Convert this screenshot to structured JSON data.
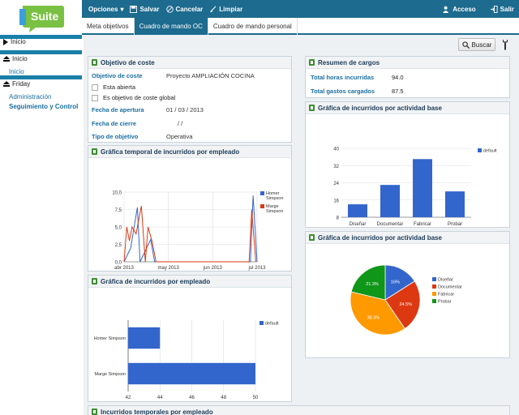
{
  "logo": {
    "text": "Suite"
  },
  "sidebar": {
    "items": [
      {
        "label": "Inicio"
      },
      {
        "label": "Inicio"
      },
      {
        "label": "Inicio"
      },
      {
        "label": "Friday"
      },
      {
        "label": "Administración"
      },
      {
        "label": "Seguimiento y Control"
      }
    ]
  },
  "topbar": {
    "opciones": "Opciones",
    "salvar": "Salvar",
    "cancelar": "Cancelar",
    "limpiar": "Limpiar",
    "acceso": "Acceso",
    "salir": "Salir"
  },
  "tabs": [
    {
      "label": "Meta objetivos"
    },
    {
      "label": "Cuadro de mando OC"
    },
    {
      "label": "Cuadro de mando personal"
    }
  ],
  "search": {
    "label": "Buscar"
  },
  "objetivo": {
    "title": "Objetivo de coste",
    "objetivo_label": "Objetivo de coste",
    "objetivo_value": "Proyecto AMPLIACIÓN COCINA",
    "abierta_label": "Esta abierta",
    "global_label": "Es objetivo de coste global",
    "apertura_label": "Fecha de apertura",
    "apertura_value": "01  /  03  /  2013",
    "cierre_label": "Fecha de cierre",
    "cierre_value": "/        /",
    "tipo_label": "Tipo de objetivo",
    "tipo_value": "Operativa"
  },
  "resumen": {
    "title": "Resumen de cargos",
    "horas_label": "Total horas incurridas",
    "horas_value": "94.0",
    "gastos_label": "Total gastos cargados",
    "gastos_value": "87.5"
  },
  "panel_titles": {
    "temporal": "Gráfica temporal de incurridos por empleado",
    "empleado": "Gráfica de incurridos por empleado",
    "actividad_bar": "Gráfica de incurridos por actividad base",
    "actividad_pie": "Gráfica de incurridos por actividad base",
    "bottom": "Incurridos temporales por empleado"
  },
  "colors": {
    "blue": "#3366cc",
    "red": "#dc3912",
    "orange": "#ff9900",
    "green": "#109618",
    "topbar": "#1d6b8e"
  },
  "chart_data": [
    {
      "type": "line",
      "x_ticks": [
        "abr 2013",
        "may 2013",
        "jun 2013",
        "jul 2013"
      ],
      "y_ticks": [
        "0,0",
        "2,5",
        "5,0",
        "7,5",
        "10,0"
      ],
      "ylim": [
        0,
        10
      ],
      "series": [
        {
          "name": "Homer Simpson",
          "color": "#3366cc",
          "points": [
            [
              0.0,
              0
            ],
            [
              0.05,
              2.0
            ],
            [
              0.08,
              5.5
            ],
            [
              0.1,
              7.8
            ],
            [
              0.12,
              0
            ],
            [
              0.2,
              3.2
            ],
            [
              0.23,
              0
            ],
            [
              0.95,
              0
            ],
            [
              0.97,
              9.5
            ],
            [
              1.0,
              0
            ]
          ]
        },
        {
          "name": "Marge Simpson",
          "color": "#dc3912",
          "points": [
            [
              0.0,
              0
            ],
            [
              0.02,
              5.0
            ],
            [
              0.04,
              3.0
            ],
            [
              0.06,
              5.0
            ],
            [
              0.09,
              4.0
            ],
            [
              0.13,
              8.0
            ],
            [
              0.16,
              0
            ],
            [
              0.18,
              5.0
            ],
            [
              0.21,
              3.0
            ],
            [
              0.24,
              0
            ],
            [
              0.94,
              0
            ],
            [
              0.96,
              7.5
            ],
            [
              0.99,
              0
            ]
          ]
        }
      ]
    },
    {
      "type": "bar",
      "orientation": "horizontal",
      "categories": [
        "Homer Simpson",
        "Marge Simpson"
      ],
      "values": [
        44,
        50
      ],
      "xlim": [
        42,
        50
      ],
      "x_ticks": [
        "42",
        "44",
        "46",
        "48",
        "50"
      ],
      "series_name": "default"
    },
    {
      "type": "bar",
      "categories": [
        "Diseñar",
        "Documentar",
        "Fabricar",
        "Probar"
      ],
      "values": [
        14,
        23,
        35,
        20
      ],
      "ylim": [
        8,
        40
      ],
      "y_ticks": [
        "8",
        "16",
        "24",
        "32",
        "40"
      ],
      "series_name": "default"
    },
    {
      "type": "pie",
      "labels": [
        "Diseñar",
        "Documentar",
        "Fabricar",
        "Probar"
      ],
      "values": [
        16,
        24.5,
        38.3,
        21.3
      ],
      "value_labels": [
        "16%",
        "24.5%",
        "38.3%",
        "21.3%"
      ]
    }
  ]
}
